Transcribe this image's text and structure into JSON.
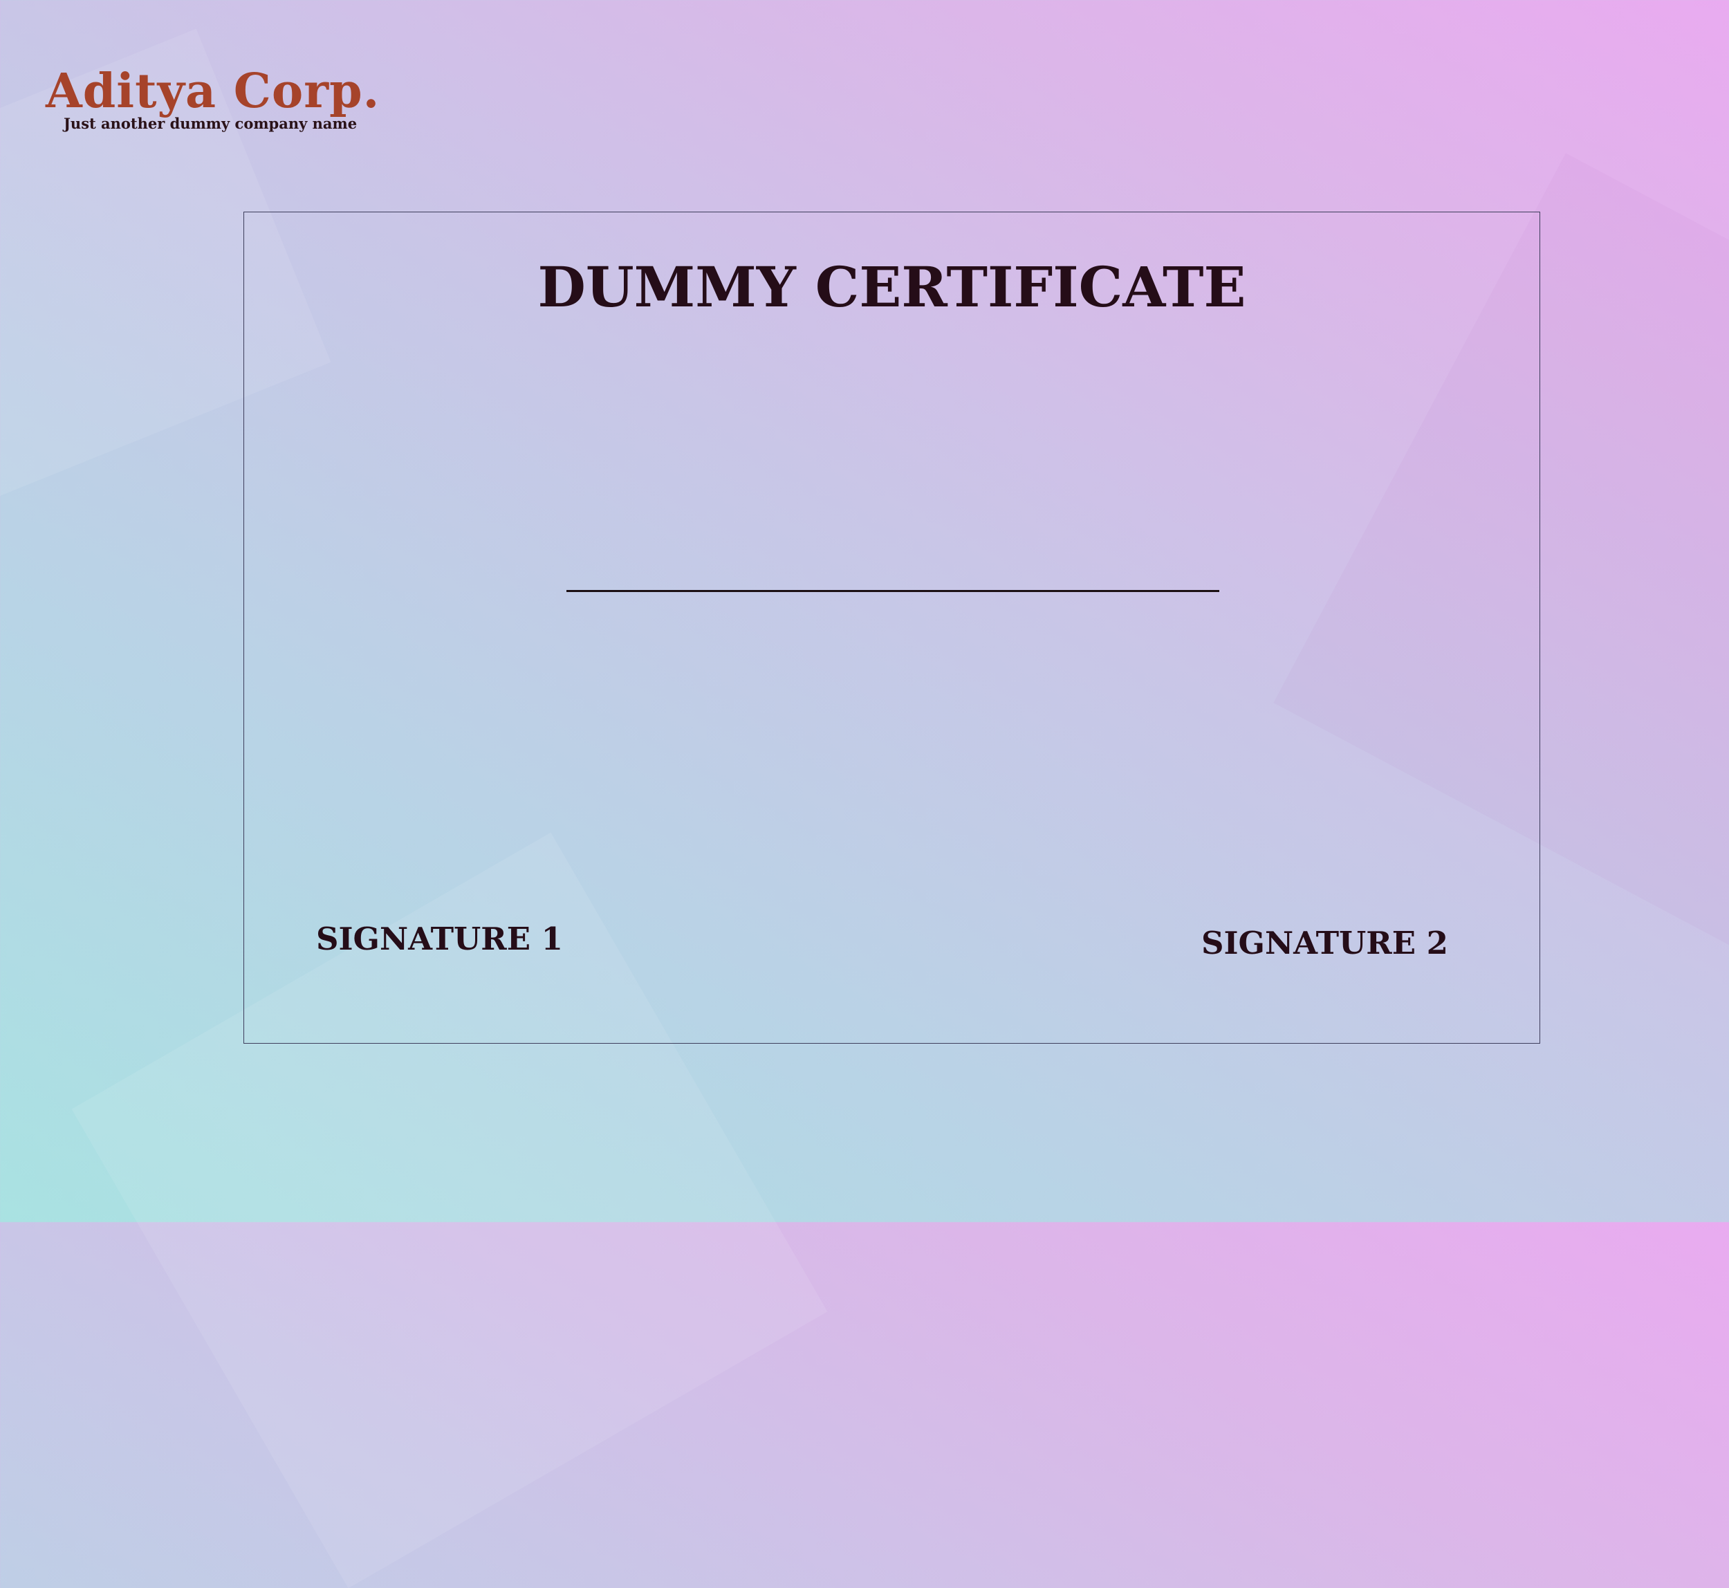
{
  "company": {
    "name": "Aditya Corp.",
    "tagline": "Just another dummy company name"
  },
  "certificate": {
    "title": "DUMMY CERTIFICATE",
    "signature_1": "SIGNATURE 1",
    "signature_2": "SIGNATURE 2"
  },
  "colors": {
    "logo_accent": "#a6432a",
    "text_dark": "#250d18",
    "frame_border": "#3e3e5c"
  }
}
